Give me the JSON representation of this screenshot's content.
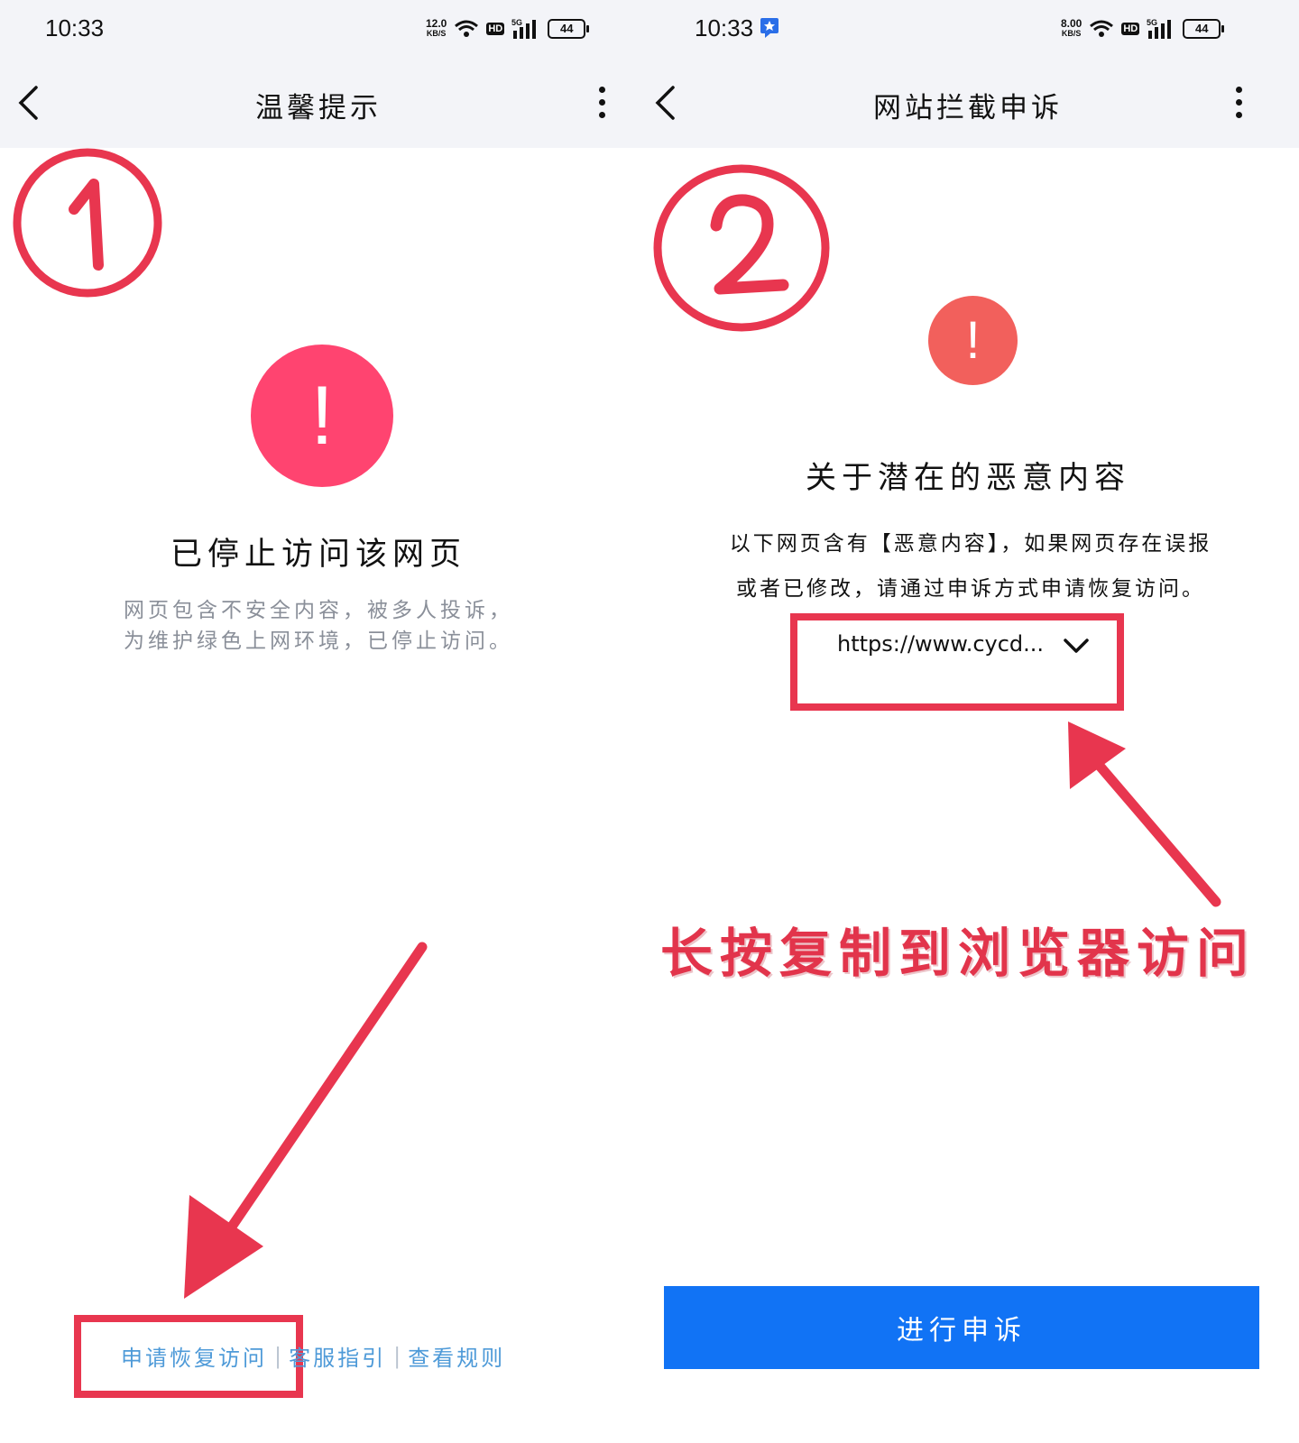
{
  "screen1": {
    "status": {
      "time": "10:33",
      "net_speed": "12.0",
      "net_unit": "KB/S",
      "hd": "HD",
      "signal_label": "5G",
      "battery": "44"
    },
    "nav": {
      "title": "温馨提示"
    },
    "step_label": "①",
    "alert_symbol": "!",
    "title": "已停止访问该网页",
    "description_line1": "网页包含不安全内容，被多人投诉，",
    "description_line2": "为维护绿色上网环境，已停止访问。",
    "footer": {
      "appeal_link": "申请恢复访问",
      "separator": "|",
      "support_link": "客服指引",
      "rules_link": "查看规则"
    }
  },
  "screen2": {
    "status": {
      "time": "10:33",
      "net_speed": "8.00",
      "net_unit": "KB/S",
      "hd": "HD",
      "signal_label": "5G",
      "battery": "44"
    },
    "nav": {
      "title": "网站拦截申诉"
    },
    "step_label": "②",
    "alert_symbol": "!",
    "title": "关于潜在的恶意内容",
    "description_line1": "以下网页含有【恶意内容】，如果网页存在误报",
    "description_line2": "或者已修改，请通过申诉方式申请恢复访问。",
    "url": "https://www.cycd...",
    "annotation": "长按复制到浏览器访问",
    "appeal_button": "进行申诉"
  },
  "colors": {
    "annotation_red": "#e8364f",
    "alert_pink": "#ff4470",
    "alert_coral": "#f2605c",
    "link_blue": "#4e9ad8",
    "button_blue": "#1173f5",
    "bar_bg": "#f3f4f8"
  },
  "icons": [
    "back-arrow-icon",
    "more-vertical-icon",
    "wifi-icon",
    "signal-icon",
    "battery-icon",
    "notification-app-icon",
    "chevron-down-icon"
  ]
}
